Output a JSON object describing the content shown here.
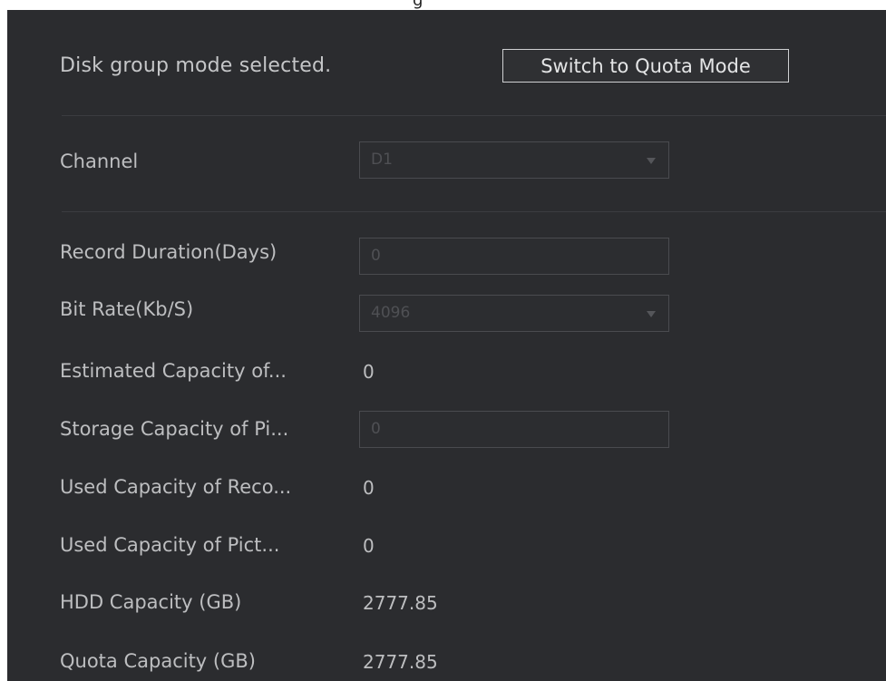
{
  "header": {
    "partial_title": "g"
  },
  "mode": {
    "text": "Disk group mode selected.",
    "switch_label": "Switch to Quota Mode"
  },
  "channel": {
    "label": "Channel",
    "value": "D1"
  },
  "fields": {
    "record_duration": {
      "label": "Record Duration(Days)",
      "value": "0"
    },
    "bit_rate": {
      "label": "Bit Rate(Kb/S)",
      "value": "4096"
    },
    "estimated_capacity": {
      "label": "Estimated Capacity of...",
      "value": "0"
    },
    "storage_capacity": {
      "label": "Storage Capacity of Pi...",
      "value": "0"
    },
    "used_capacity_record": {
      "label": "Used Capacity of Reco...",
      "value": "0"
    },
    "used_capacity_picture": {
      "label": "Used Capacity of Pict...",
      "value": "0"
    },
    "hdd_capacity": {
      "label": "HDD Capacity (GB)",
      "value": "2777.85"
    },
    "quota_capacity": {
      "label": "Quota Capacity (GB)",
      "value": "2777.85"
    }
  },
  "colors": {
    "panel_bg": "#2b2c2f",
    "text": "#c5c6c8",
    "disabled_text": "#4f5054"
  }
}
